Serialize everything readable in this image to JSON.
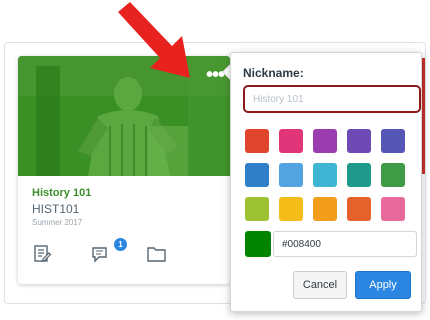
{
  "course_card": {
    "nickname": "History 101",
    "course_code": "HIST101",
    "term": "Summer 2017",
    "hero_color": "#2f8a22",
    "nickname_color": "#3c8f2c",
    "kebab_label": "•••",
    "discussion_badge_count": "1",
    "badge_color": "#2a86e0",
    "icons": [
      "assignments-icon",
      "discussions-icon",
      "files-icon"
    ]
  },
  "popover": {
    "label": "Nickname:",
    "nickname_placeholder": "History 101",
    "nickname_value": "",
    "swatch_colors": [
      "#e0462d",
      "#e1357a",
      "#9b3db0",
      "#6e4ab5",
      "#5556b5",
      "#2f80c9",
      "#52a3e0",
      "#3fb5d3",
      "#1f9a8a",
      "#3f9b45",
      "#9dc233",
      "#f4bd1a",
      "#f29d1c",
      "#e5622c",
      "#e86a9b"
    ],
    "selected_color": "#008400",
    "hex_value": "#008400",
    "cancel_label": "Cancel",
    "apply_label": "Apply",
    "apply_color": "#2a86e0"
  },
  "annotation": {
    "arrow_color": "#e8231f"
  }
}
